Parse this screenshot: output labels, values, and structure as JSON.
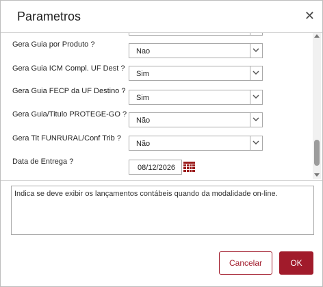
{
  "dialog": {
    "title": "Parametros",
    "close_icon": "close-icon"
  },
  "fields": [
    {
      "label": "Gera Guia por Produto ?",
      "value": "Nao"
    },
    {
      "label": "Gera Guia ICM Compl. UF Dest ?",
      "value": "Sim"
    },
    {
      "label": "Gera Guia FECP da UF Destino ?",
      "value": "Sim"
    },
    {
      "label": "Gera Guia/Titulo PROTEGE-GO ?",
      "value": "Não"
    },
    {
      "label": "Gera Tit FUNRURAL/Conf Trib ?",
      "value": "Não"
    }
  ],
  "date_field": {
    "label": "Data de Entrega ?",
    "value": "08/12/2026",
    "icon": "calendar-icon"
  },
  "help_text": "Indica se deve exibir os lançamentos contábeis quando da modalidade on-line.",
  "buttons": {
    "cancel": "Cancelar",
    "ok": "OK"
  },
  "colors": {
    "accent": "#a11b2b",
    "calendar": "#9b1c1c"
  }
}
